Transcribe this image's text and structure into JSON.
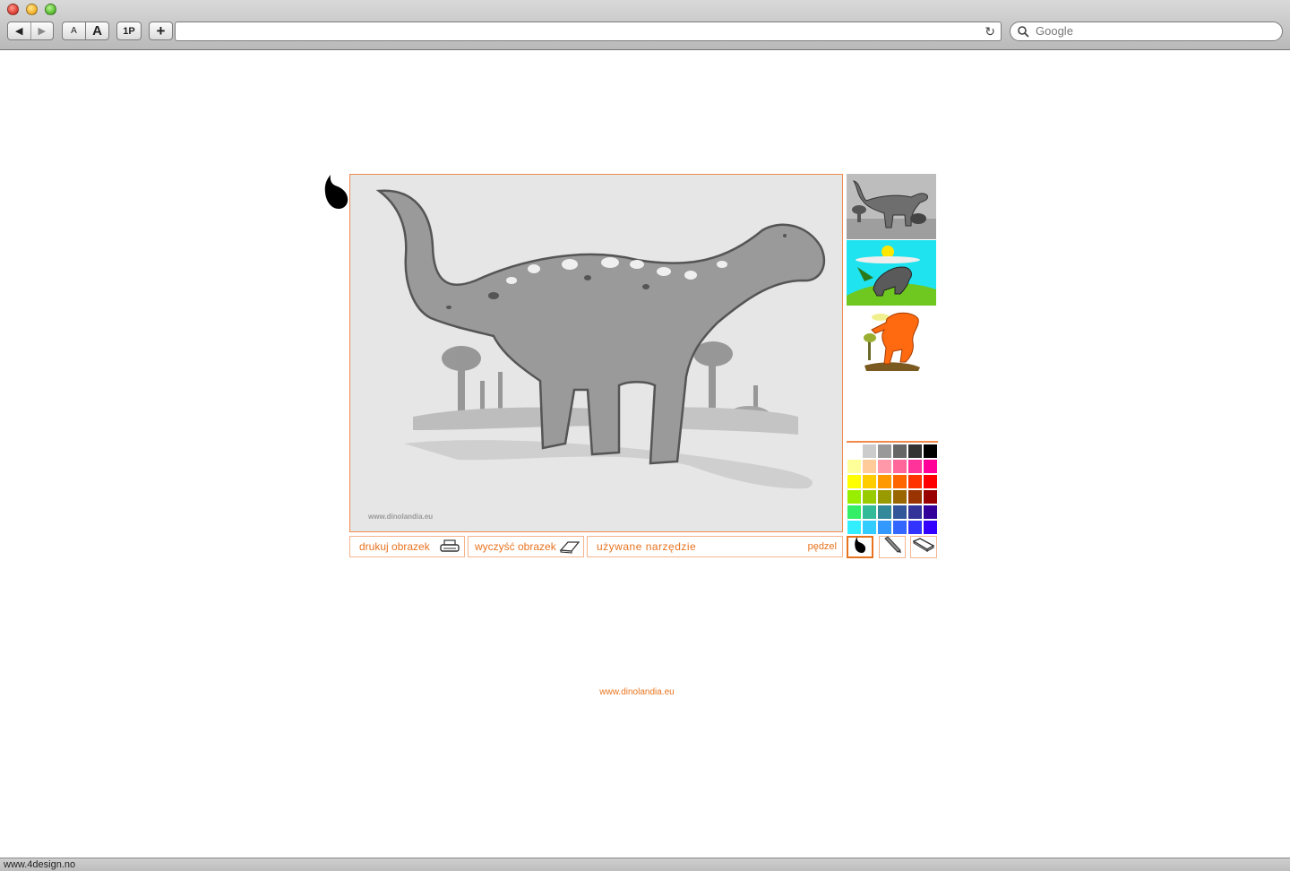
{
  "browser": {
    "nav": {
      "back_icon": "back-arrow-icon",
      "forward_icon": "forward-arrow-icon"
    },
    "text_smaller_label": "A",
    "text_larger_label": "A",
    "readability_label": "1P",
    "add_bookmark_label": "+",
    "address_value": "",
    "search_placeholder": "Google",
    "status_text": "www.4design.no"
  },
  "app": {
    "canvas_watermark": "www.dinolandia.eu",
    "buttons": {
      "print_label": "drukuj obrazek",
      "clear_label": "wyczyść obrazek"
    },
    "tool_status": {
      "label": "używane narzędzie",
      "value": "pędzel"
    },
    "tools": [
      "brush-drop-icon",
      "pencil-icon",
      "eraser-icon"
    ],
    "active_tool": "pędzel",
    "footer_link": "www.dinolandia.eu",
    "palette": [
      [
        "#ffffff",
        "#cccccc",
        "#999999",
        "#666666",
        "#333333",
        "#000000"
      ],
      [
        "#ffff99",
        "#ffcc99",
        "#ff99aa",
        "#ff6699",
        "#ff3399",
        "#ff0099"
      ],
      [
        "#ffff00",
        "#ffcc00",
        "#ff9900",
        "#ff6600",
        "#ff3300",
        "#ff0000"
      ],
      [
        "#99ee00",
        "#99cc00",
        "#999900",
        "#996600",
        "#993300",
        "#990000"
      ],
      [
        "#33ee66",
        "#33bb99",
        "#338899",
        "#335599",
        "#333399",
        "#330099"
      ],
      [
        "#33eeff",
        "#33ccff",
        "#3399ff",
        "#3366ff",
        "#3333ff",
        "#3300ff"
      ]
    ],
    "accent_color": "#e8731f"
  }
}
